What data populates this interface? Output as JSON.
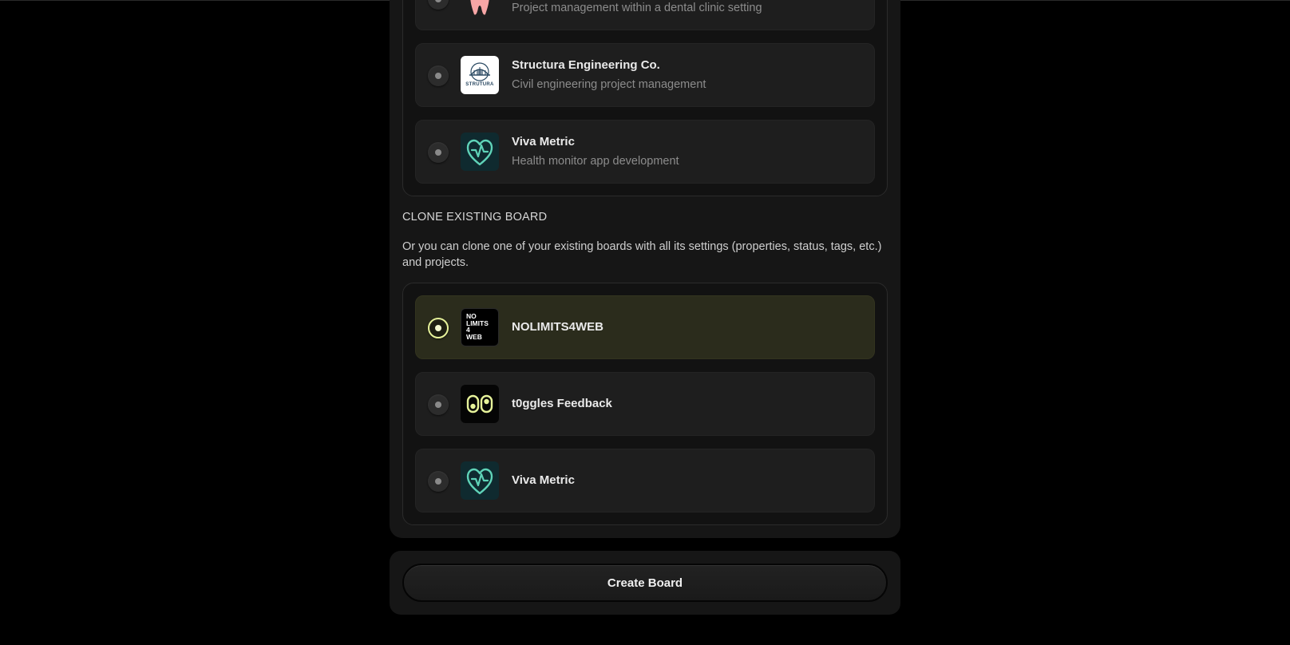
{
  "templates": {
    "items": [
      {
        "title": "",
        "description": "Project management within a dental clinic setting",
        "logo": "tooth-logo-icon"
      },
      {
        "title": "Structura Engineering Co.",
        "description": "Civil engineering project management",
        "logo": "structura-bridge-logo-icon",
        "logo_text": "STRUTURA"
      },
      {
        "title": "Viva Metric",
        "description": "Health monitor app development",
        "logo": "heart-pulse-logo-icon"
      }
    ]
  },
  "clone": {
    "heading": "CLONE EXISTING BOARD",
    "description": "Or you can clone one of your existing boards with all its settings (properties, status, tags, etc.) and projects.",
    "items": [
      {
        "title": "NOLIMITS4WEB",
        "selected": true,
        "logo": "nolimits4web-logo-icon",
        "logo_lines": [
          "NO",
          "LIMITS",
          "4",
          "WEB"
        ]
      },
      {
        "title": "t0ggles Feedback",
        "selected": false,
        "logo": "t0ggles-logo-icon"
      },
      {
        "title": "Viva Metric",
        "selected": false,
        "logo": "heart-pulse-logo-icon"
      }
    ]
  },
  "actions": {
    "create_label": "Create Board"
  },
  "colors": {
    "accent": "#e6f29a",
    "selected_bg": "#2b2c1c",
    "teal": "#5fd3b8",
    "tooth": "#f7a6a6"
  }
}
